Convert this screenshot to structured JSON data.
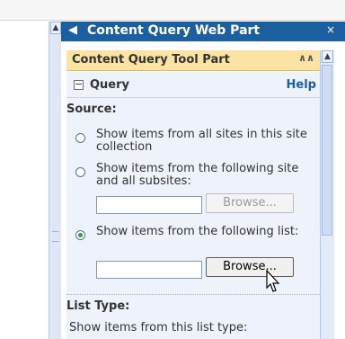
{
  "panel": {
    "title": "Content Query Web Part",
    "close": "×"
  },
  "toolpart": {
    "title": "Content Query Tool Part",
    "collapse_icon": "double-chevron-up-icon"
  },
  "query": {
    "expand_glyph": "−",
    "label": "Query",
    "help": "Help"
  },
  "source": {
    "label": "Source:",
    "options": [
      {
        "label": "Show items from all sites in this site collection",
        "selected": false
      },
      {
        "label": "Show items from the following site and all subsites:",
        "selected": false,
        "textbox_value": "",
        "button": "Browse...",
        "button_enabled": false
      },
      {
        "label": "Show items from the following list:",
        "selected": true,
        "textbox_value": "",
        "button": "Browse...",
        "button_enabled": true
      }
    ]
  },
  "list_type": {
    "label": "List Type:",
    "prompt": "Show items from this list type:"
  },
  "icons": {
    "scroll_up": "▲",
    "panel_menu": "◀"
  }
}
